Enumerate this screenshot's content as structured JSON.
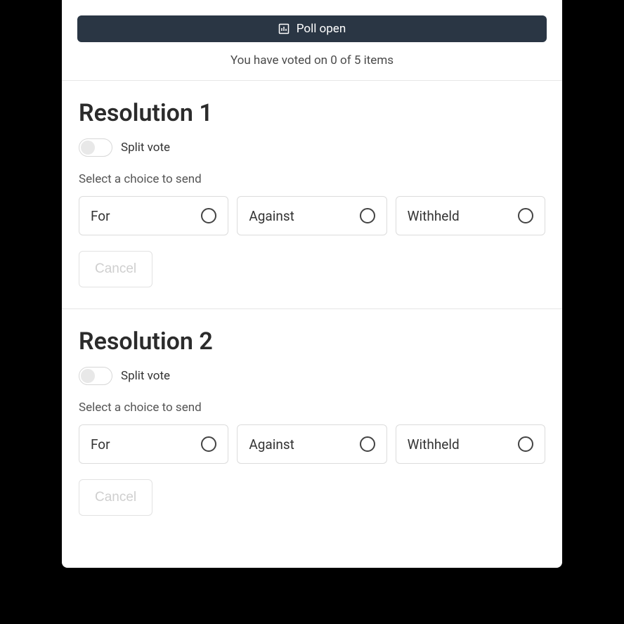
{
  "header": {
    "poll_status": "Poll open",
    "voted_status": "You have voted on 0 of 5 items"
  },
  "resolutions": [
    {
      "title": "Resolution 1",
      "split_label": "Split vote",
      "instruction": "Select a choice to send",
      "choices": [
        "For",
        "Against",
        "Withheld"
      ],
      "cancel_label": "Cancel"
    },
    {
      "title": "Resolution 2",
      "split_label": "Split vote",
      "instruction": "Select a choice to send",
      "choices": [
        "For",
        "Against",
        "Withheld"
      ],
      "cancel_label": "Cancel"
    }
  ]
}
